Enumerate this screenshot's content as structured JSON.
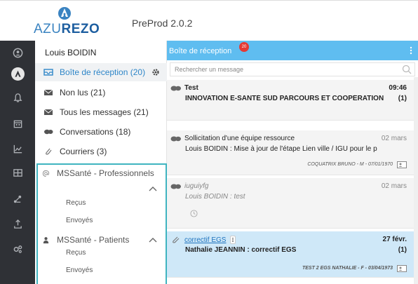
{
  "header": {
    "logo_part1": "AZU",
    "logo_part2": "REZO",
    "env_label": "PreProd 2.0.2"
  },
  "rail": {
    "icons": [
      "user-icon",
      "azurezo-icon",
      "bell-icon",
      "calendar-icon",
      "chart-icon",
      "grid-icon",
      "share-icon",
      "upload-icon",
      "settings-icon"
    ],
    "active_index": 1
  },
  "folders": {
    "user_name": "Louis BOIDIN",
    "items": [
      {
        "label": "Boîte de réception (20)",
        "icon": "inbox-icon",
        "active": true
      },
      {
        "label": "Non lus (21)",
        "icon": "envelope-icon"
      },
      {
        "label": "Tous les messages (21)",
        "icon": "envelope-icon"
      },
      {
        "label": "Conversations (18)",
        "icon": "conversation-icon"
      },
      {
        "label": "Courriers (3)",
        "icon": "paperclip-icon"
      }
    ],
    "mssante_pro": {
      "title": "MSSanté - Professionnels",
      "received": "Reçus",
      "sent": "Envoyés"
    },
    "mssante_patients": {
      "title": "MSSanté - Patients",
      "received": "Reçus",
      "sent": "Envoyés"
    }
  },
  "messages": {
    "title": "Boîte de réception",
    "badge": "20",
    "search_placeholder": "Rechercher un message",
    "accent_color": "#5fbdf0",
    "items": [
      {
        "sender": "Test",
        "date": "09:46",
        "subject": "INNOVATION E-SANTÉ SUD PARCOURS ET COOPÉRATION : Te",
        "count": "(1)"
      },
      {
        "sender": "Sollicitation d'une équipe ressource",
        "date": "02 mars",
        "subject": "Louis BOIDIN : Mise à jour de l'étape Lien ville / IGU pour le p",
        "meta": "COQUATRIX BRUNO - M - 07/01/1970"
      },
      {
        "sender": "iuguiyfg",
        "date": "02 mars",
        "subject": "Louis BOIDIN : test"
      },
      {
        "sender": "correctif EGS",
        "date": "27 févr.",
        "subject": "Nathalie JEANNIN : correctif EGS",
        "count": "(1)",
        "meta": "TEST 2 EGS NATHALIE - F - 03/04/1973"
      }
    ]
  }
}
